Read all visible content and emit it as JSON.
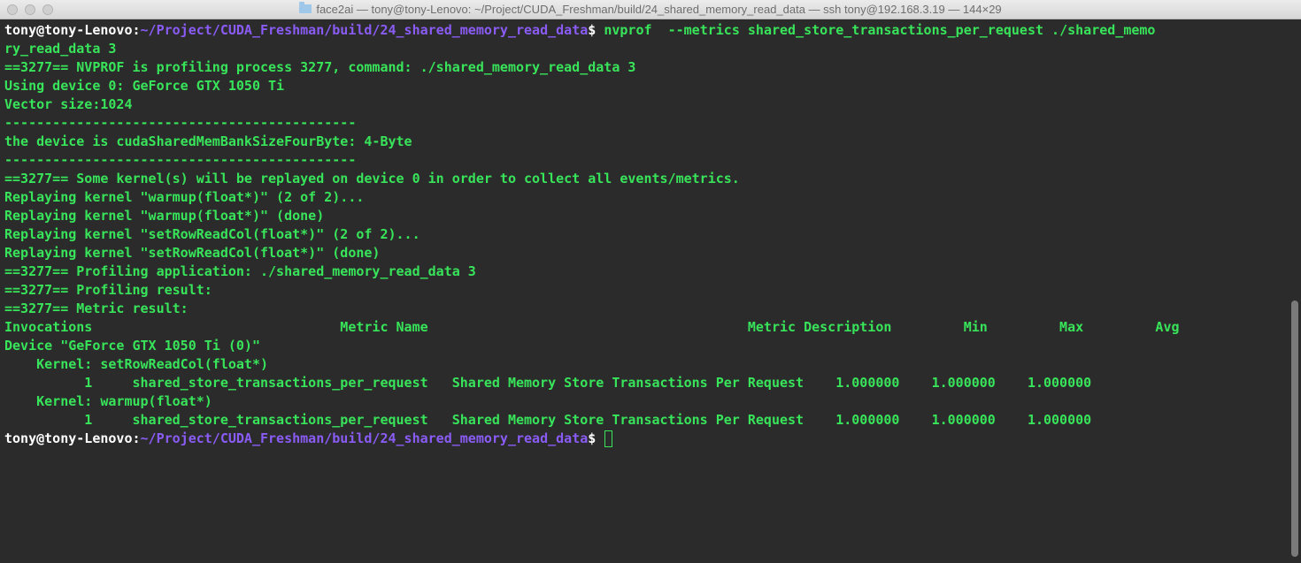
{
  "window": {
    "title": "face2ai — tony@tony-Lenovo: ~/Project/CUDA_Freshman/build/24_shared_memory_read_data — ssh tony@192.168.3.19 — 144×29"
  },
  "terminal": {
    "prompt_host": "tony@tony-Lenovo",
    "prompt_sep": ":",
    "prompt_path": "~/Project/CUDA_Freshman/build/24_shared_memory_read_data",
    "prompt_dollar": "$ ",
    "command_line": "nvprof  --metrics shared_store_transactions_per_request ./shared_memo",
    "command_wrap": "ry_read_data 3",
    "output": [
      "==3277== NVPROF is profiling process 3277, command: ./shared_memory_read_data 3",
      "Using device 0: GeForce GTX 1050 Ti",
      "Vector size:1024",
      "--------------------------------------------",
      "the device is cudaSharedMemBankSizeFourByte: 4-Byte",
      "--------------------------------------------",
      "==3277== Some kernel(s) will be replayed on device 0 in order to collect all events/metrics.",
      "Replaying kernel \"warmup(float*)\" (2 of 2)...",
      "Replaying kernel \"warmup(float*)\" (done)",
      "Replaying kernel \"setRowReadCol(float*)\" (2 of 2)...",
      "Replaying kernel \"setRowReadCol(float*)\" (done)",
      "==3277== Profiling application: ./shared_memory_read_data 3",
      "==3277== Profiling result:",
      "==3277== Metric result:",
      "Invocations                               Metric Name                                        Metric Description         Min         Max         Avg",
      "Device \"GeForce GTX 1050 Ti (0)\"",
      "    Kernel: setRowReadCol(float*)",
      "          1     shared_store_transactions_per_request   Shared Memory Store Transactions Per Request    1.000000    1.000000    1.000000",
      "    Kernel: warmup(float*)",
      "          1     shared_store_transactions_per_request   Shared Memory Store Transactions Per Request    1.000000    1.000000    1.000000"
    ]
  }
}
